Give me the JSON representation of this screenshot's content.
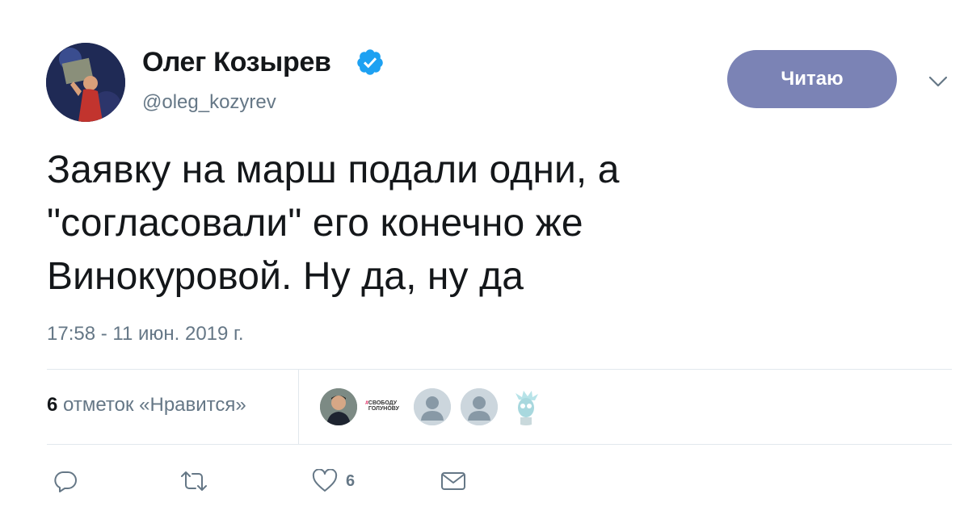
{
  "author": {
    "name": "Олег Козырев",
    "handle": "@oleg_kozyrev",
    "verified": true
  },
  "follow_button": {
    "label": "Читаю"
  },
  "tweet": {
    "lines": [
      "Заявку на марш подали одни, а",
      "\"согласовали\" его конечно же",
      "Винокуровой. Ну да, ну да"
    ],
    "timestamp": "17:58 - 11 июн. 2019 г."
  },
  "likes": {
    "count": "6",
    "label": "отметок «Нравится»",
    "liker_badge": {
      "hash": "#",
      "line1": "СВОБОДУ",
      "line2": "ГОЛУНОВУ"
    }
  },
  "actions": {
    "like_count": "6",
    "icons": [
      "reply-icon",
      "retweet-icon",
      "heart-icon",
      "envelope-icon"
    ]
  },
  "colors": {
    "follow_button": "#7b83b5",
    "verified": "#1da1f2",
    "secondary_text": "#657786",
    "divider": "#e1e8ed"
  }
}
